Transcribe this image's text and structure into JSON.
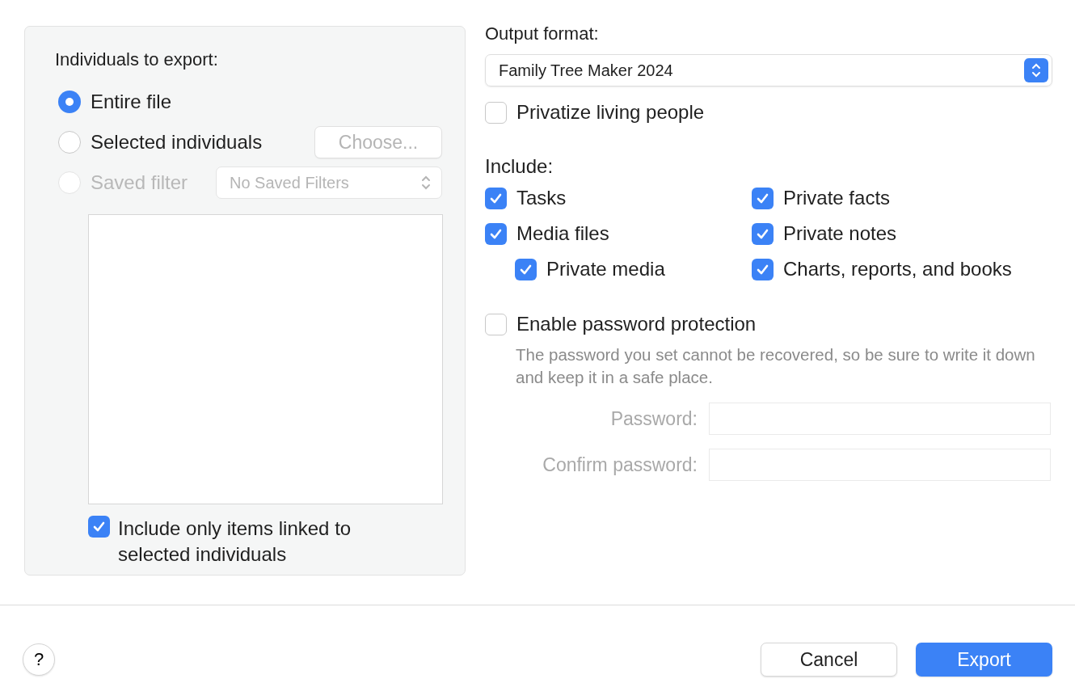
{
  "export_scope": {
    "title": "Individuals to export:",
    "options": [
      {
        "label": "Entire file",
        "selected": true,
        "disabled": false
      },
      {
        "label": "Selected individuals",
        "selected": false,
        "disabled": false,
        "button": {
          "label": "Choose...",
          "disabled": true
        }
      },
      {
        "label": "Saved filter",
        "selected": false,
        "disabled": true,
        "dropdown": {
          "value": "No Saved Filters",
          "disabled": true
        }
      }
    ],
    "linked_only": {
      "label": "Include only items linked to selected individuals",
      "checked": true
    }
  },
  "output": {
    "label": "Output format:",
    "format": "Family Tree Maker 2024",
    "privatize": {
      "label": "Privatize living people",
      "checked": false
    }
  },
  "include": {
    "label": "Include:",
    "columns": [
      [
        {
          "label": "Tasks",
          "checked": true
        },
        {
          "label": "Media files",
          "checked": true,
          "children": [
            {
              "label": "Private media",
              "checked": true
            }
          ]
        }
      ],
      [
        {
          "label": "Private facts",
          "checked": true
        },
        {
          "label": "Private notes",
          "checked": true
        },
        {
          "label": "Charts, reports, and books",
          "checked": true
        }
      ]
    ]
  },
  "password": {
    "label": "Enable password protection",
    "checked": false,
    "note": "The password you set cannot be recovered, so be sure to write it down and keep it in a safe place.",
    "fields": [
      {
        "label": "Password:",
        "disabled": true
      },
      {
        "label": "Confirm password:",
        "disabled": true
      }
    ]
  },
  "footer": {
    "help": "?",
    "buttons": [
      {
        "label": "Cancel",
        "kind": "secondary"
      },
      {
        "label": "Export",
        "kind": "primary"
      }
    ]
  }
}
